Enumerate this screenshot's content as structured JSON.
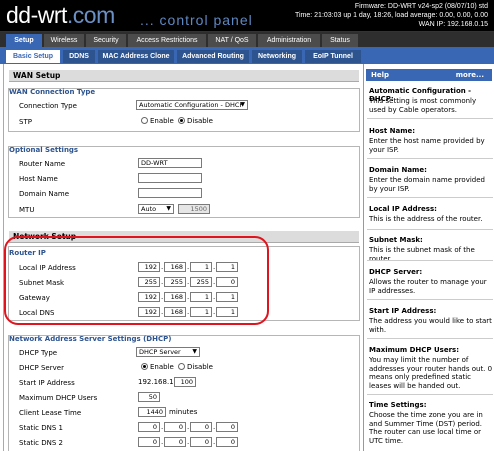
{
  "header": {
    "logo_main": "dd-wrt",
    "logo_com": ".com",
    "subtitle": "... control panel",
    "info_lines": [
      "Firmware: DD-WRT v24-sp2 (08/07/10) std",
      "Time: 21:03:03 up 1 day, 18:26, load average: 0.00, 0.00, 0.00",
      "WAN IP: 192.168.0.15"
    ]
  },
  "nav": {
    "tabs": [
      "Setup",
      "Wireless",
      "Security",
      "Access Restrictions",
      "NAT / QoS",
      "Administration",
      "Status"
    ],
    "active": "Setup"
  },
  "subnav": {
    "tabs": [
      "Basic Setup",
      "DDNS",
      "MAC Address Clone",
      "Advanced Routing",
      "Networking",
      "EoIP Tunnel"
    ],
    "active": "Basic Setup"
  },
  "wan": {
    "section": "WAN Setup",
    "conn_title": "WAN Connection Type",
    "conn_label": "Connection Type",
    "conn_value": "Automatic Configuration - DHCP",
    "stp_label": "STP",
    "enable": "Enable",
    "disable": "Disable",
    "stp_selected": "Disable"
  },
  "optional": {
    "title": "Optional Settings",
    "router_name_label": "Router Name",
    "router_name": "DD-WRT",
    "host_name_label": "Host Name",
    "host_name": "",
    "domain_name_label": "Domain Name",
    "domain_name": "",
    "mtu_label": "MTU",
    "mtu_mode": "Auto",
    "mtu_value": "1500"
  },
  "network": {
    "section": "Network Setup",
    "router_ip_title": "Router IP",
    "local_ip_label": "Local IP Address",
    "local_ip": [
      "192",
      "168",
      "1",
      "1"
    ],
    "subnet_label": "Subnet Mask",
    "subnet": [
      "255",
      "255",
      "255",
      "0"
    ],
    "gateway_label": "Gateway",
    "gateway": [
      "192",
      "168",
      "1",
      "1"
    ],
    "dns_label": "Local DNS",
    "dns": [
      "192",
      "168",
      "1",
      "1"
    ]
  },
  "dhcp": {
    "title": "Network Address Server Settings (DHCP)",
    "type_label": "DHCP Type",
    "type_value": "DHCP Server",
    "server_label": "DHCP Server",
    "enable": "Enable",
    "disable": "Disable",
    "server_selected": "Enable",
    "start_label": "Start IP Address",
    "start_prefix": "192.168.1.",
    "start_value": "100",
    "max_label": "Maximum DHCP Users",
    "max_value": "50",
    "lease_label": "Client Lease Time",
    "lease_value": "1440",
    "lease_unit": "minutes",
    "dns1_label": "Static DNS 1",
    "dns1": [
      "0",
      "0",
      "0",
      "0"
    ],
    "dns2_label": "Static DNS 2",
    "dns2": [
      "0",
      "0",
      "0",
      "0"
    ]
  },
  "help": {
    "title": "Help",
    "more": "more...",
    "items": [
      {
        "title": "Automatic Configuration - DHCP:",
        "text": "This setting is most commonly used by Cable operators."
      },
      {
        "title": "Host Name:",
        "text": "Enter the host name provided by your ISP."
      },
      {
        "title": "Domain Name:",
        "text": "Enter the domain name provided by your ISP."
      },
      {
        "title": "Local IP Address:",
        "text": "This is the address of the router."
      },
      {
        "title": "Subnet Mask:",
        "text": "This is the subnet mask of the router."
      },
      {
        "title": "DHCP Server:",
        "text": "Allows the router to manage your IP addresses."
      },
      {
        "title": "Start IP Address:",
        "text": "The address you would like to start with."
      },
      {
        "title": "Maximum DHCP Users:",
        "text": "You may limit the number of addresses your router hands out. 0 means only predefined static leases will be handed out."
      },
      {
        "title": "Time Settings:",
        "text": "Choose the time zone you are in and Summer Time (DST) period. The router can use local time or UTC time."
      }
    ]
  },
  "colors": {
    "accent": "#3a67b4",
    "highlight": "#e0141d"
  }
}
